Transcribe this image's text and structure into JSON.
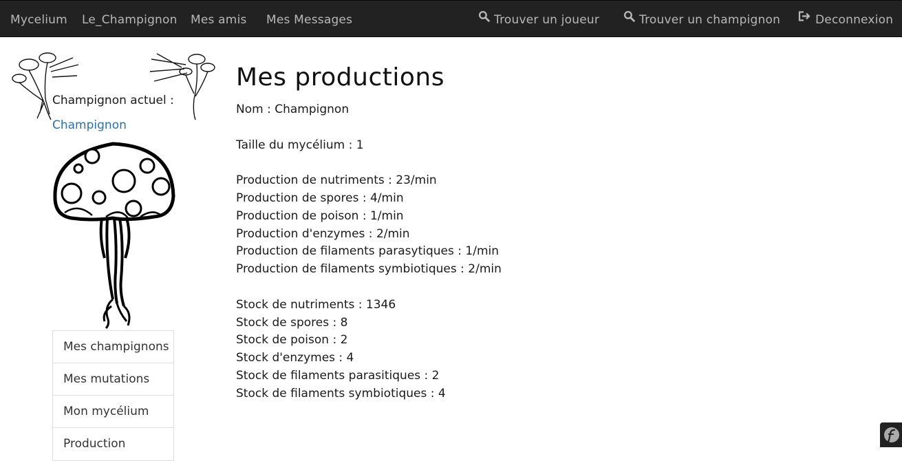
{
  "navbar": {
    "left_items": [
      {
        "label": "Mycelium"
      },
      {
        "label": "Le_Champignon"
      },
      {
        "label": "Mes amis"
      },
      {
        "label": "Mes Messages"
      }
    ],
    "right_items": [
      {
        "label": "Trouver un joueur",
        "icon": "search-icon"
      },
      {
        "label": "Trouver un champignon",
        "icon": "search-icon"
      },
      {
        "label": "Deconnexion",
        "icon": "logout-icon"
      }
    ]
  },
  "sidebar": {
    "current_label": "Champignon actuel :",
    "current_name": "Champignon",
    "menu": [
      {
        "label": "Mes champignons"
      },
      {
        "label": "Mes mutations"
      },
      {
        "label": "Mon mycélium"
      },
      {
        "label": "Production"
      }
    ]
  },
  "main": {
    "title": "Mes productions",
    "name_line": "Nom : Champignon",
    "size_line": "Taille du mycélium : 1",
    "production": [
      "Production de nutriments : 23/min",
      "Production de spores : 4/min",
      "Production de poison : 1/min",
      "Production d'enzymes : 2/min",
      "Production de filaments parasytiques : 1/min",
      "Production de filaments symbiotiques : 2/min"
    ],
    "stock": [
      "Stock de nutriments : 1346",
      "Stock de spores : 8",
      "Stock de poison : 2",
      "Stock d'enzymes : 4",
      "Stock de filaments parasitiques : 2",
      "Stock de filaments symbiotiques : 4"
    ]
  },
  "colors": {
    "navbar_bg": "#222222",
    "nav_text": "#b8b8b8",
    "link": "#2a6fa8"
  },
  "icons": {
    "debug_toolbar": "symfony-icon"
  }
}
